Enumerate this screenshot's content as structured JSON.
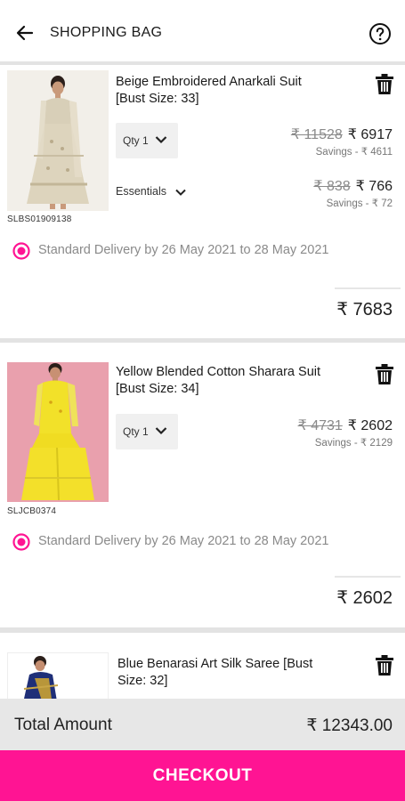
{
  "header": {
    "title": "SHOPPING BAG",
    "back_icon": "arrow-left-icon",
    "help_icon": "help-circle-icon"
  },
  "items": [
    {
      "title": "Beige Embroidered Anarkali Suit [Bust Size: 33]",
      "sku": "SLBS01909138",
      "qty_label": "Qty 1",
      "mrp": "₹ 11528",
      "price": "₹ 6917",
      "savings": "Savings - ₹ 4611",
      "essentials_label": "Essentials",
      "essentials_mrp": "₹ 838",
      "essentials_price": "₹ 766",
      "essentials_savings": "Savings - ₹ 72",
      "delivery": "Standard Delivery by 26 May 2021 to 28 May 2021",
      "subtotal": "₹ 7683"
    },
    {
      "title": "Yellow Blended Cotton Sharara Suit [Bust Size: 34]",
      "sku": "SLJCB0374",
      "qty_label": "Qty 1",
      "mrp": "₹ 4731",
      "price": "₹ 2602",
      "savings": "Savings - ₹ 2129",
      "delivery": "Standard Delivery by 26 May 2021 to 28 May 2021",
      "subtotal": "₹ 2602"
    },
    {
      "title": "Blue Benarasi Art Silk Saree [Bust Size: 32]"
    }
  ],
  "total": {
    "label": "Total Amount",
    "value": "₹ 12343.00"
  },
  "checkout_label": "CHECKOUT",
  "colors": {
    "accent": "#ff1493",
    "total_bar": "#e7e7e7",
    "divider": "#e3e3e3"
  }
}
